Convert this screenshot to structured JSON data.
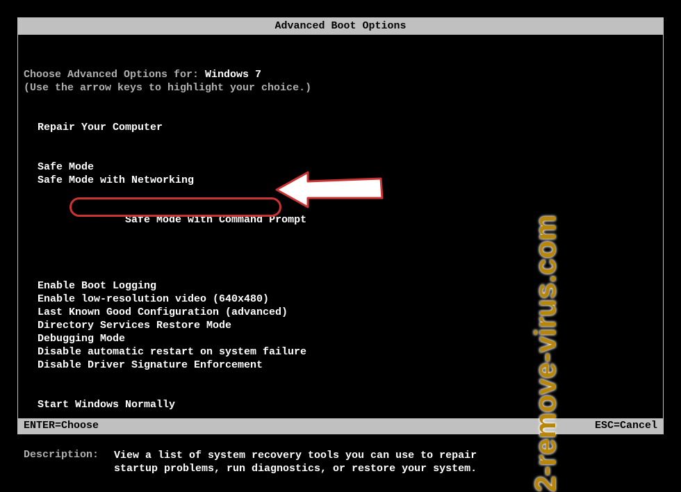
{
  "title": "Advanced Boot Options",
  "prompt_label": "Choose Advanced Options for: ",
  "os_name": "Windows 7",
  "instructions": "(Use the arrow keys to highlight your choice.)",
  "options": {
    "repair": "Repair Your Computer",
    "safe_mode": "Safe Mode",
    "safe_mode_net": "Safe Mode with Networking",
    "safe_mode_cmd": "Safe Mode with Command Prompt",
    "boot_log": "Enable Boot Logging",
    "low_res": "Enable low-resolution video (640x480)",
    "lkgc": "Last Known Good Configuration (advanced)",
    "dsrm": "Directory Services Restore Mode",
    "debug": "Debugging Mode",
    "no_restart": "Disable automatic restart on system failure",
    "no_sig": "Disable Driver Signature Enforcement",
    "normal": "Start Windows Normally"
  },
  "description_label": "Description:",
  "description_line1": "View a list of system recovery tools you can use to repair",
  "description_line2": "startup problems, run diagnostics, or restore your system.",
  "footer_enter": "ENTER=Choose",
  "footer_esc": "ESC=Cancel",
  "watermark": "2-remove-virus.com"
}
